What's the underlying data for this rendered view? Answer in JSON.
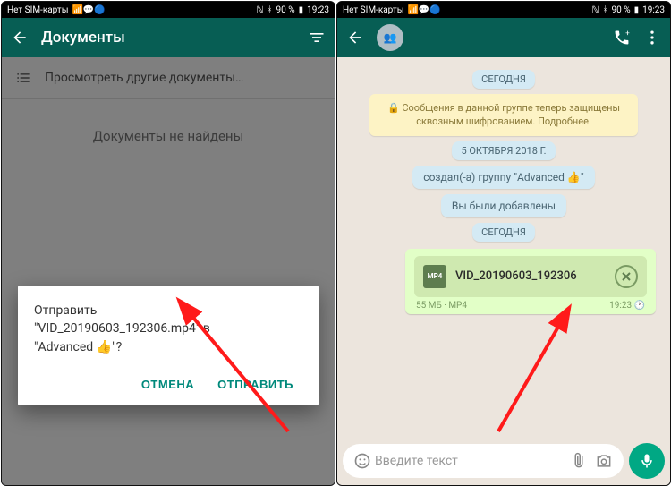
{
  "status": {
    "sim": "Нет SIM-карты",
    "battery": "90 %",
    "time": "19:23"
  },
  "left": {
    "title": "Документы",
    "browse": "Просмотреть другие документы…",
    "empty": "Документы не найдены",
    "dialog": {
      "line1": "Отправить",
      "line2": "\"VID_20190603_192306.mp4\" в",
      "line3": "\"Advanced 👍\"?",
      "cancel": "ОТМЕНА",
      "send": "ОТПРАВИТЬ"
    }
  },
  "right": {
    "today": "СЕГОДНЯ",
    "encryption": "🔒 Сообщения в данной группе теперь защищены сквозным шифрованием. Подробнее.",
    "date2": "5 ОКТЯБРЯ 2018 Г.",
    "created": "создал(-а) группу \"Advanced 👍\"",
    "added": "Вы были добавлены",
    "today2": "СЕГОДНЯ",
    "file": {
      "icon_label": "MP4",
      "name": "VID_20190603_192306",
      "size": "55 МБ · MP4",
      "time": "19:23"
    },
    "input": {
      "placeholder": "Введите текст"
    }
  }
}
